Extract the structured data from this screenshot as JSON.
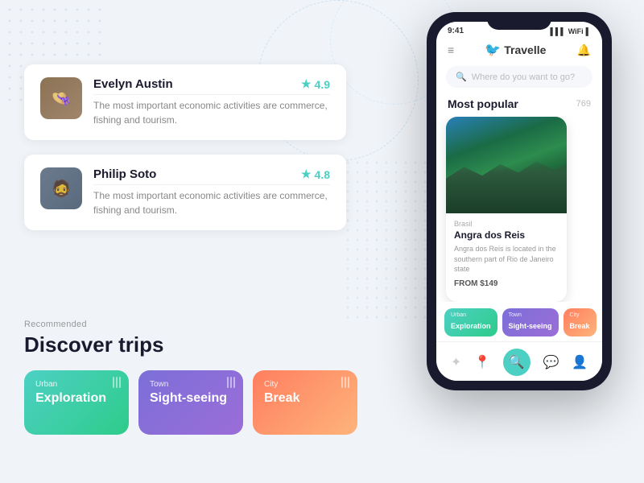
{
  "app": {
    "title": "Travelle",
    "logo_icon": "🐦"
  },
  "status_bar": {
    "time": "9:41",
    "signal": "▌▌▌",
    "wifi": "WiFi",
    "battery": "🔋"
  },
  "search": {
    "placeholder": "Where do you want to go?"
  },
  "reviewers": [
    {
      "name": "Evelyn Austin",
      "rating": "4.9",
      "text": "The most important economic activities are commerce, fishing  and tourism."
    },
    {
      "name": "Philip Soto",
      "rating": "4.8",
      "text": "The most important economic activities are commerce, fishing  and tourism."
    }
  ],
  "discover": {
    "recommended_label": "Recommended",
    "title": "Discover trips",
    "trips": [
      {
        "type": "Urban",
        "name": "Exploration",
        "color_class": "trip-card-urban"
      },
      {
        "type": "Town",
        "name": "Sight-seeing",
        "color_class": "trip-card-town"
      },
      {
        "type": "City",
        "name": "Break",
        "color_class": "trip-card-city"
      }
    ]
  },
  "most_popular": {
    "title": "Most popular",
    "count": "769"
  },
  "destinations": [
    {
      "country": "Brasil",
      "name": "Angra dos Reis",
      "description": "Angra dos Reis is located in the southern part of Rio de Janeiro state",
      "price": "FROM $149"
    }
  ],
  "phone_trips": [
    {
      "type": "Urban",
      "name": "Exploration"
    },
    {
      "type": "Town",
      "name": "Sight-seeing"
    },
    {
      "type": "City",
      "name": "Break"
    }
  ],
  "bottom_nav": {
    "icons": [
      "✦",
      "📍",
      "🔍",
      "💬",
      "👤"
    ],
    "active_index": 2
  }
}
